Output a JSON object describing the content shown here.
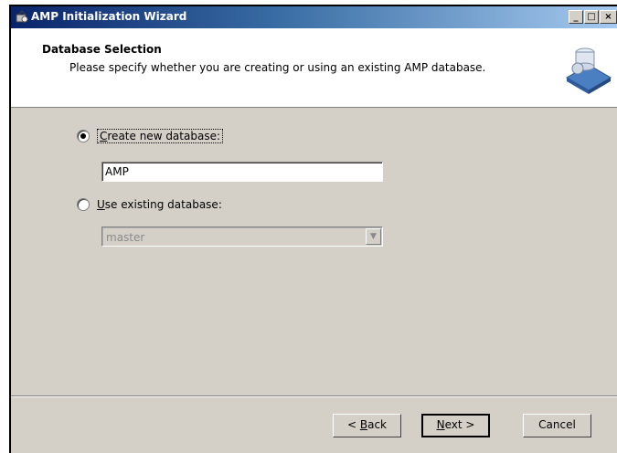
{
  "window": {
    "title": "AMP Initialization Wizard",
    "controls": {
      "minimize": "_",
      "maximize": "□",
      "close": "×"
    }
  },
  "header": {
    "title": "Database Selection",
    "subtitle": "Please specify whether you are creating or using an existing AMP database."
  },
  "options": {
    "create_new": {
      "label_accel": "C",
      "label_rest": "reate new database:",
      "selected": true
    },
    "new_db_name": "AMP",
    "use_existing": {
      "label_accel": "U",
      "label_rest": "se existing database:",
      "selected": false
    },
    "existing_db_value": "master"
  },
  "buttons": {
    "back_prefix": "< ",
    "back_accel": "B",
    "back_rest": "ack",
    "next_accel": "N",
    "next_rest": "ext >",
    "cancel": "Cancel"
  },
  "icons": {
    "title": "wizard-icon",
    "header": "database-wizard-icon",
    "dropdown": "chevron-down-icon"
  }
}
